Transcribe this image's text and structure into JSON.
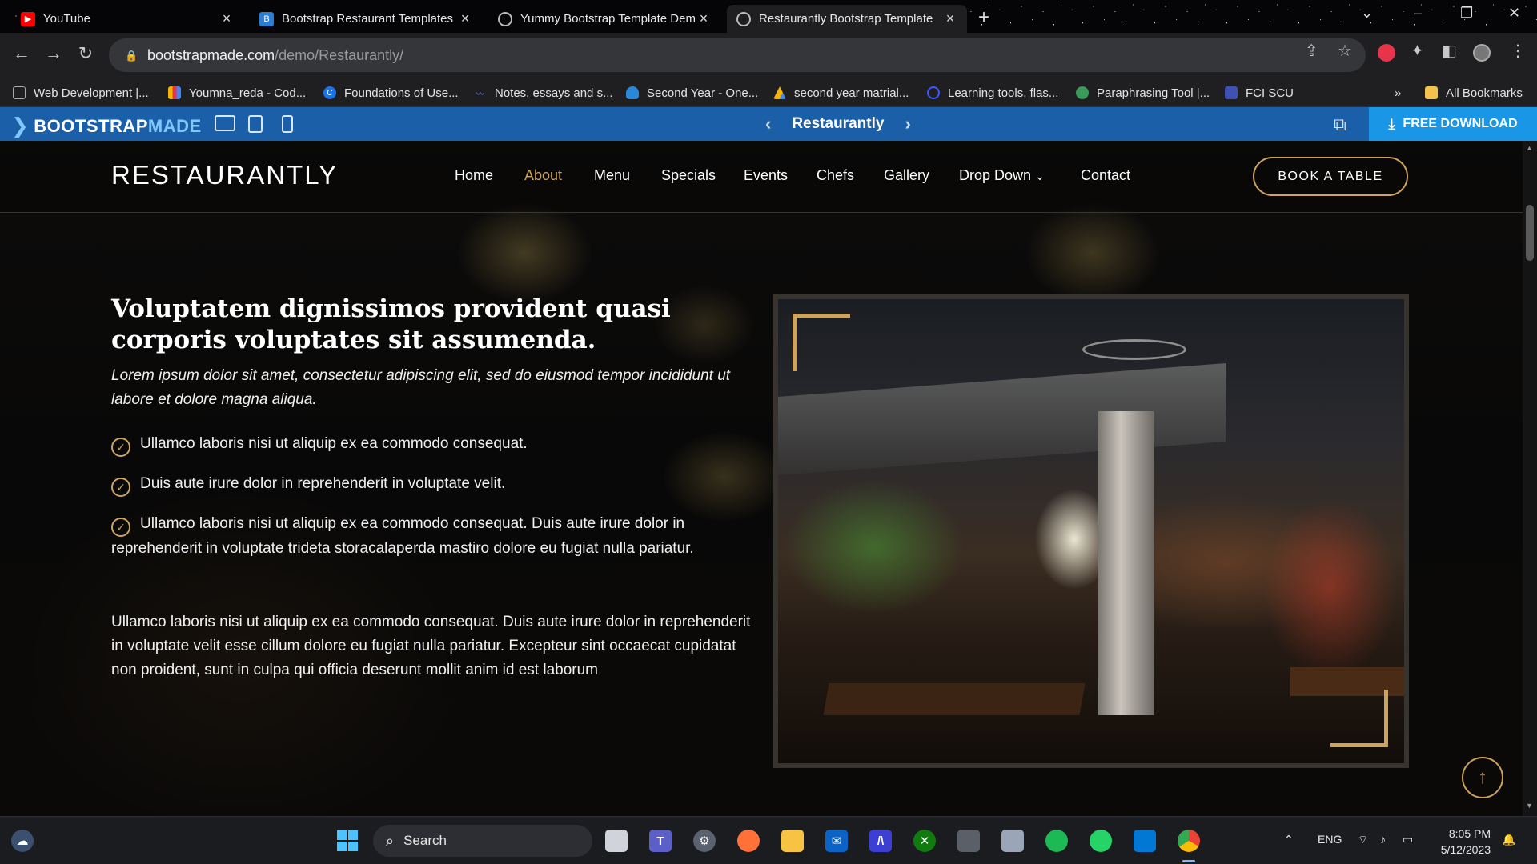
{
  "browser": {
    "tabs": [
      {
        "label": "YouTube",
        "icon": "youtube-icon"
      },
      {
        "label": "Bootstrap Restaurant Templates",
        "icon": "bootstrapmade-icon"
      },
      {
        "label": "Yummy Bootstrap Template Dem",
        "icon": "globe-icon"
      },
      {
        "label": "Restaurantly Bootstrap Template",
        "icon": "globe-icon"
      }
    ],
    "url_host": "bootstrapmade.com",
    "url_path": "/demo/Restaurantly/",
    "bookmarks": [
      "Web Development |...",
      "Youmna_reda - Cod...",
      "Foundations of Use...",
      "Notes, essays and s...",
      "Second Year - One...",
      "second year matrial...",
      "Learning tools, flas...",
      "Paraphrasing Tool |...",
      "FCI SCU",
      "All Bookmarks"
    ],
    "bookmarks_overflow": "»"
  },
  "bmbar": {
    "logo_a": "BOOTSTRAP",
    "logo_b": "MADE",
    "template_name": "Restaurantly",
    "download_label": "FREE DOWNLOAD"
  },
  "site": {
    "brand": "RESTAURANTLY",
    "nav": [
      "Home",
      "About",
      "Menu",
      "Specials",
      "Events",
      "Chefs",
      "Gallery",
      "Drop Down",
      "Contact"
    ],
    "active_nav": "About",
    "cta": "BOOK A TABLE",
    "accent": "#cda45e"
  },
  "about": {
    "heading": "Voluptatem dignissimos provident quasi corporis voluptates sit assumenda.",
    "lead": "Lorem ipsum dolor sit amet, consectetur adipiscing elit, sed do eiusmod tempor incididunt ut labore et dolore magna aliqua.",
    "checks": [
      "Ullamco laboris nisi ut aliquip ex ea commodo consequat.",
      "Duis aute irure dolor in reprehenderit in voluptate velit.",
      "Ullamco laboris nisi ut aliquip ex ea commodo consequat. Duis aute irure dolor in reprehenderit in voluptate trideta storacalaperda mastiro dolore eu fugiat nulla pariatur."
    ],
    "paragraph": "Ullamco laboris nisi ut aliquip ex ea commodo consequat. Duis aute irure dolor in reprehenderit in voluptate velit esse cillum dolore eu fugiat nulla pariatur. Excepteur sint occaecat cupidatat non proident, sunt in culpa qui officia deserunt mollit anim id est laborum"
  },
  "taskbar": {
    "search_label": "Search",
    "language": "ENG",
    "time": "8:05 PM",
    "date": "5/12/2023"
  }
}
